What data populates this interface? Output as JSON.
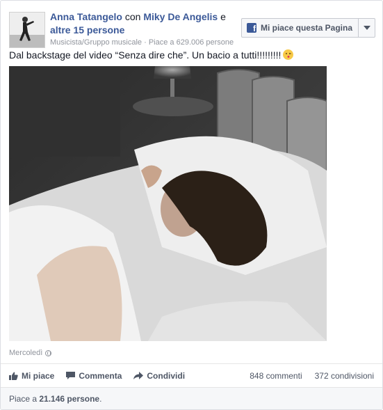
{
  "post": {
    "author": "Anna Tatangelo",
    "con": " con ",
    "tagged": "Miky De Angelis",
    "and_others_prefix": " e ",
    "others": "altre 15 persone",
    "category": "Musicista/Gruppo musicale",
    "separator": " · ",
    "page_likes": "Piace a 629.006 persone",
    "like_page_button": "Mi piace questa Pagina",
    "caption": "Dal backstage del video “Senza dire che”. Un bacio a tutti!!!!!!!!!",
    "date": "Mercoledì",
    "photo_icon": "photo-bw-bed"
  },
  "actions": {
    "like": "Mi piace",
    "comment": "Commenta",
    "share": "Condividi",
    "comments_count": "848 commenti",
    "shares_count": "372 condivisioni"
  },
  "footer": {
    "prefix": "Piace a ",
    "count": "21.146 persone",
    "suffix": "."
  },
  "colors": {
    "link": "#3b5998",
    "muted": "#90949c",
    "action": "#4e5665"
  }
}
